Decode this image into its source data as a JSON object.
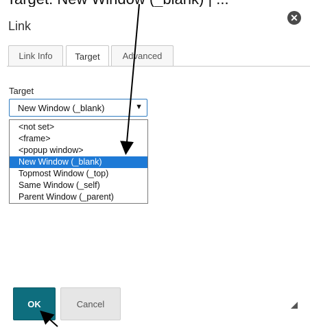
{
  "top_caption": "Target: New Window (_blank) | ...",
  "dialog": {
    "title": "Link",
    "close_icon": "close-circle-icon"
  },
  "tabs": [
    {
      "label": "Link Info",
      "active": false
    },
    {
      "label": "Target",
      "active": true
    },
    {
      "label": "Advanced",
      "active": false
    }
  ],
  "target": {
    "label": "Target",
    "selected_value": "New Window (_blank)",
    "arrow": "▼",
    "options": [
      "<not set>",
      "<frame>",
      "<popup window>",
      "New Window (_blank)",
      "Topmost Window (_top)",
      "Same Window (_self)",
      "Parent Window (_parent)"
    ],
    "highlighted_option": "New Window (_blank)"
  },
  "buttons": {
    "ok": "OK",
    "cancel": "Cancel"
  },
  "colors": {
    "ok_bg": "#0e6e7e",
    "highlight": "#1e7ad6",
    "select_border": "#2e7bc0"
  },
  "icons": {
    "resize": "resize-grip-icon"
  }
}
